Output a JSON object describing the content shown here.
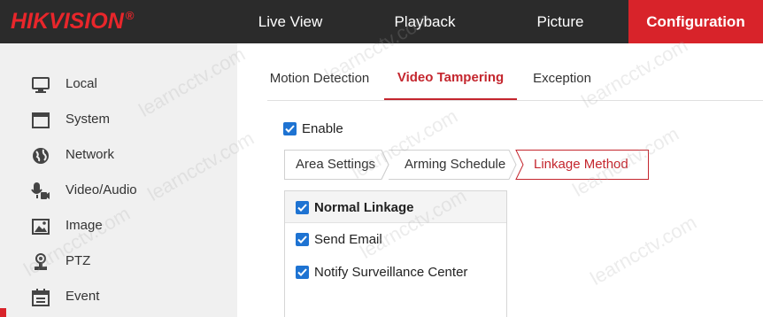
{
  "brand": {
    "hik": "HIK",
    "vision": "VISION",
    "reg": "®"
  },
  "nav": {
    "live_view": "Live View",
    "playback": "Playback",
    "picture": "Picture",
    "configuration": "Configuration"
  },
  "sidebar": {
    "items": [
      {
        "label": "Local",
        "icon": "monitor-icon"
      },
      {
        "label": "System",
        "icon": "window-icon"
      },
      {
        "label": "Network",
        "icon": "globe-icon"
      },
      {
        "label": "Video/Audio",
        "icon": "microphone-camera-icon"
      },
      {
        "label": "Image",
        "icon": "image-icon"
      },
      {
        "label": "PTZ",
        "icon": "ptz-icon"
      },
      {
        "label": "Event",
        "icon": "calendar-icon"
      }
    ]
  },
  "subtabs": {
    "motion": "Motion Detection",
    "tampering": "Video Tampering",
    "exception": "Exception"
  },
  "enable": {
    "label": "Enable",
    "checked": true
  },
  "steps": {
    "area": "Area Settings",
    "arming": "Arming Schedule",
    "linkage": "Linkage Method"
  },
  "linkage": {
    "header": "Normal Linkage",
    "options": [
      {
        "label": "Send Email",
        "checked": true
      },
      {
        "label": "Notify Surveillance Center",
        "checked": true
      }
    ]
  },
  "colors": {
    "accent": "#d8232a",
    "checkbox": "#1e73d2",
    "topbar": "#2b2b2b",
    "sidebar": "#f0f0f0"
  },
  "watermark": "learncctv.com"
}
